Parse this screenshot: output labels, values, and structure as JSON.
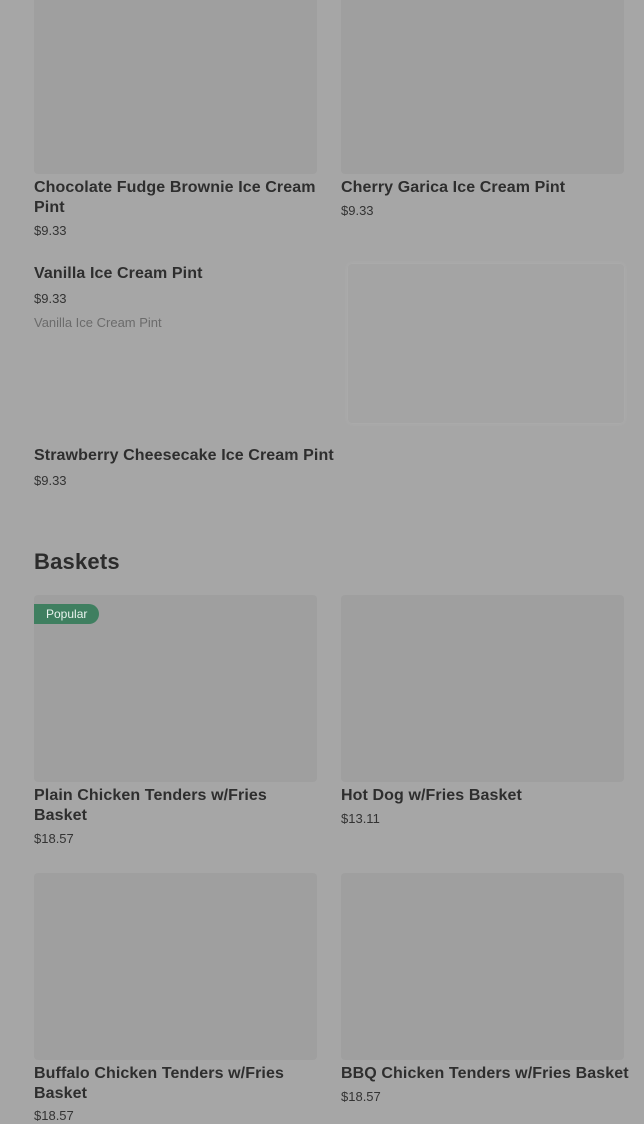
{
  "ice_cream": {
    "items": [
      {
        "title": "Chocolate Fudge Brownie Ice Cream Pint",
        "price": "$9.33"
      },
      {
        "title": "Cherry Garica Ice Cream Pint",
        "price": "$9.33"
      },
      {
        "title": "Vanilla Ice Cream Pint",
        "price": "$9.33",
        "description": "Vanilla Ice Cream Pint"
      },
      {
        "title": "Strawberry Cheesecake Ice Cream Pint",
        "price": "$9.33"
      }
    ]
  },
  "baskets": {
    "heading": "Baskets",
    "items": [
      {
        "title": "Plain Chicken Tenders w/Fries Basket",
        "price": "$18.57",
        "badge": "Popular"
      },
      {
        "title": "Hot Dog w/Fries Basket",
        "price": "$13.11"
      },
      {
        "title": "Buffalo Chicken Tenders w/Fries Basket",
        "price": "$18.57"
      },
      {
        "title": "BBQ Chicken Tenders w/Fries Basket",
        "price": "$18.57"
      }
    ]
  }
}
